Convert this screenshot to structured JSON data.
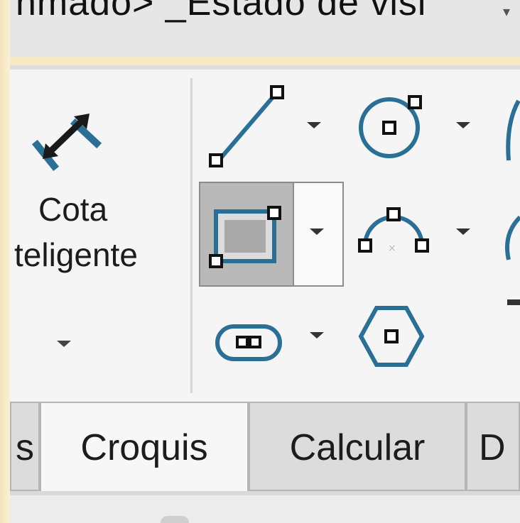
{
  "window": {
    "title": "nmado> _Estado de visi"
  },
  "ribbon": {
    "smart_dimension": {
      "line1": "Cota",
      "line2": "teligente"
    }
  },
  "tabs": [
    {
      "label": "s",
      "active": false
    },
    {
      "label": "Croquis",
      "active": true
    },
    {
      "label": "Calcular",
      "active": false
    },
    {
      "label": "D",
      "active": false
    }
  ],
  "colors": {
    "icon_blue": "#2a6f96",
    "accent_teal": "#1f7ea0"
  }
}
